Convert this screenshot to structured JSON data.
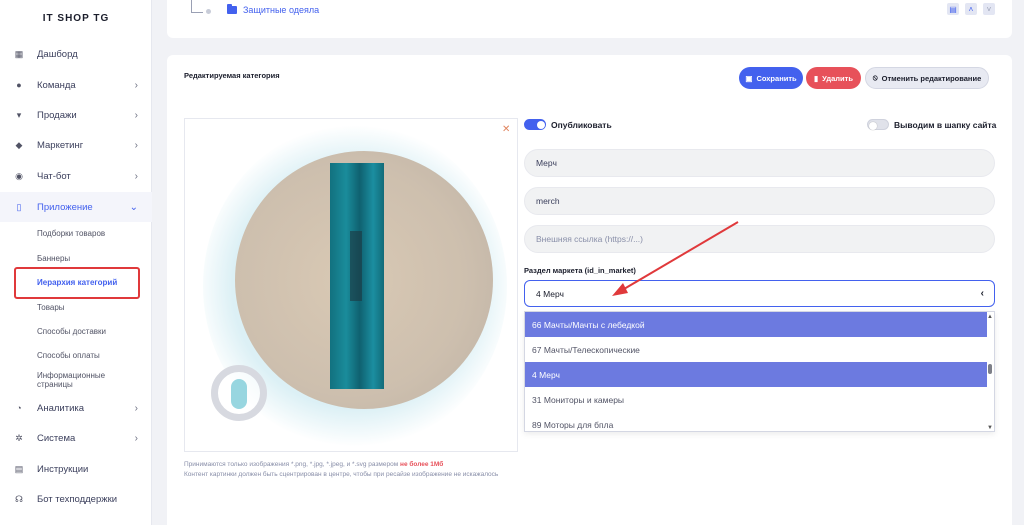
{
  "app": {
    "brand": "IT SHOP TG"
  },
  "sidebar": {
    "items": [
      {
        "label": "Дашборд",
        "icon": "grid-icon"
      },
      {
        "label": "Команда",
        "icon": "users-icon"
      },
      {
        "label": "Продажи",
        "icon": "cart-icon"
      },
      {
        "label": "Маркетинг",
        "icon": "megaphone-icon"
      },
      {
        "label": "Чат-бот",
        "icon": "robot-icon"
      },
      {
        "label": "Приложение",
        "icon": "phone-icon"
      },
      {
        "label": "Аналитика",
        "icon": "pie-chart-icon"
      },
      {
        "label": "Система",
        "icon": "gears-icon"
      },
      {
        "label": "Инструкции",
        "icon": "book-icon"
      },
      {
        "label": "Бот техподдержки",
        "icon": "headset-icon"
      }
    ],
    "subitems": [
      "Подборки товаров",
      "Баннеры",
      "Иерархия категорий",
      "Товары",
      "Способы доставки",
      "Способы оплаты",
      "Информационные страницы"
    ]
  },
  "tree": {
    "category": "Защитные одеяла"
  },
  "editor": {
    "title": "Редактируемая категория",
    "save_label": "Сохранить",
    "delete_label": "Удалить",
    "cancel_label": "Отменить редактирование",
    "publish_label": "Опубликовать",
    "publish_on": true,
    "header_label": "Выводим в шапку сайта",
    "header_on": false,
    "name_value": "Мерч",
    "slug_value": "merch",
    "link_placeholder": "Внешняя ссылка (https://...)",
    "market_label": "Раздел маркета (id_in_market)",
    "market_selected": "4 Мерч",
    "options": [
      "66 Мачты/Мачты с лебедкой",
      "67 Мачты/Телескопические",
      "4 Мерч",
      "31 Мониторы и камеры",
      "89 Моторы для бпла"
    ],
    "hint_main": "Принимаются только изображения *.png, *.jpg, *.jpeg, и *.svg размером",
    "hint_warn": "не более 1Мб",
    "hint_center": "Контент картинки должен быть сцентрирован в центре, чтобы при ресайзе изображение не искажалось"
  },
  "colors": {
    "accent": "#4361ee",
    "danger": "#e7515a",
    "annotation": "#e0393b"
  }
}
